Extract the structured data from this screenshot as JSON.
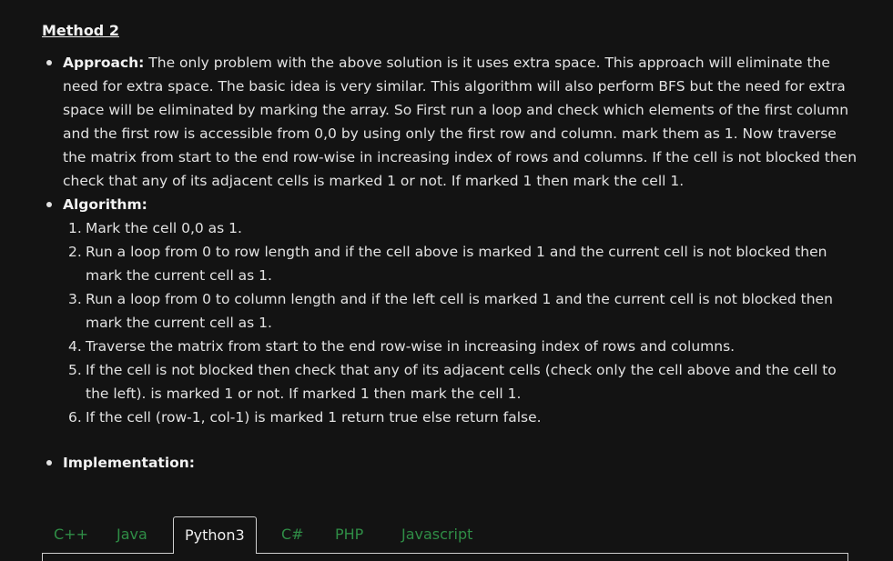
{
  "heading": "Method 2",
  "approach": {
    "label": "Approach:",
    "text": " The only problem with the above solution is it uses extra space. This approach will eliminate the need for extra space. The basic idea is very similar. This algorithm will also perform BFS but the need for extra space will be eliminated by marking the array. So First run a loop and check which elements of the first column and the first row is accessible from 0,0 by using only the first row and column. mark them as 1. Now traverse the matrix from start to the end row-wise in increasing index of rows and columns. If the cell is not blocked then check that any of its adjacent cells is marked 1 or not. If marked 1 then mark the cell 1."
  },
  "algorithm": {
    "label": "Algorithm:",
    "steps": [
      {
        "num": "1.",
        "text": "Mark the cell 0,0 as 1."
      },
      {
        "num": "2.",
        "text": "Run a loop from 0 to row length and if the cell above is marked 1 and the current cell is not blocked then mark the current cell as 1."
      },
      {
        "num": "3.",
        "text": "Run a loop from 0 to column length and if the left cell is marked 1 and the current cell is not blocked then mark the current cell as 1."
      },
      {
        "num": "4.",
        "text": "Traverse the matrix from start to the end row-wise in increasing index of rows and columns."
      },
      {
        "num": "5.",
        "text": "If the cell is not blocked then check that any of its adjacent cells (check only the cell above and the cell to the left). is marked 1 or not. If marked 1 then mark the cell 1."
      },
      {
        "num": "6.",
        "text": "If the cell (row-1, col-1) is marked 1 return true else return false."
      }
    ]
  },
  "implementation": {
    "label": "Implementation:"
  },
  "tabs": [
    {
      "label": "C++",
      "active": false
    },
    {
      "label": "Java",
      "active": false
    },
    {
      "label": "Python3",
      "active": true
    },
    {
      "label": "C#",
      "active": false
    },
    {
      "label": "PHP",
      "active": false
    },
    {
      "label": "Javascript",
      "active": false
    }
  ],
  "colors": {
    "background": "#131313",
    "text": "#e2e2e2",
    "tab_link": "#2f8d46",
    "tab_border": "#cfcfcf"
  }
}
